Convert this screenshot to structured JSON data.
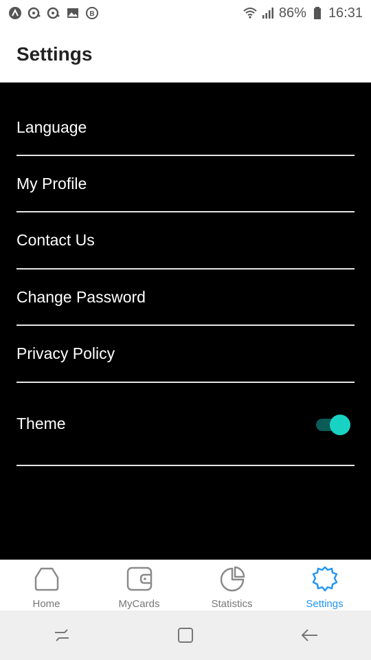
{
  "status_bar": {
    "battery": "86%",
    "time": "16:31",
    "left_icons": [
      "app-a-icon",
      "notification-icon",
      "notification-icon",
      "image-icon",
      "b-badge-icon"
    ],
    "right_icons": [
      "wifi-icon",
      "signal-icon",
      "battery-icon"
    ]
  },
  "header": {
    "title": "Settings"
  },
  "settings": {
    "items": [
      {
        "label": "Language"
      },
      {
        "label": "My Profile"
      },
      {
        "label": "Contact Us"
      },
      {
        "label": "Change Password"
      },
      {
        "label": "Privacy Policy"
      },
      {
        "label": "Theme"
      }
    ],
    "theme_toggle": {
      "on": true,
      "track_color": "#0b5b56",
      "thumb_color": "#18d3c4"
    }
  },
  "bottom_nav": {
    "items": [
      {
        "label": "Home",
        "icon": "home-icon"
      },
      {
        "label": "MyCards",
        "icon": "wallet-icon"
      },
      {
        "label": "Statistics",
        "icon": "pie-chart-icon"
      },
      {
        "label": "Settings",
        "icon": "gear-icon",
        "active": true
      }
    ],
    "active_color": "#2196f3"
  },
  "system_nav": {
    "buttons": [
      "recents-icon",
      "home-square-icon",
      "back-arrow-icon"
    ]
  }
}
